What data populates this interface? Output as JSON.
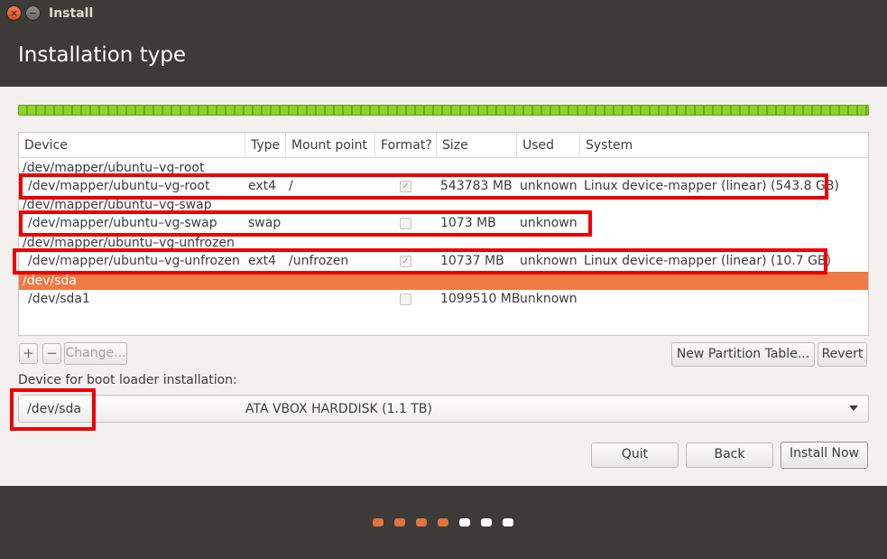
{
  "window": {
    "title": "Install"
  },
  "page": {
    "title": "Installation type"
  },
  "progress": {
    "fraction": 1.0,
    "color": "#8fd12b"
  },
  "table": {
    "headers": [
      "Device",
      "Type",
      "Mount point",
      "Format?",
      "Size",
      "Used",
      "System"
    ],
    "groups": [
      {
        "name": "/dev/mapper/ubuntu–vg-root",
        "rows": [
          {
            "device": "/dev/mapper/ubuntu–vg-root",
            "type": "ext4",
            "mount": "/",
            "format": true,
            "size": "543783 MB",
            "used": "unknown",
            "system": "Linux device-mapper (linear) (543.8 GB)"
          }
        ]
      },
      {
        "name": "/dev/mapper/ubuntu–vg-swap",
        "rows": [
          {
            "device": "/dev/mapper/ubuntu–vg-swap",
            "type": "swap",
            "mount": "",
            "format": false,
            "size": "1073 MB",
            "used": "unknown",
            "system": ""
          }
        ]
      },
      {
        "name": "/dev/mapper/ubuntu–vg-unfrozen",
        "rows": [
          {
            "device": "/dev/mapper/ubuntu–vg-unfrozen",
            "type": "ext4",
            "mount": "/unfrozen",
            "format": true,
            "size": "10737 MB",
            "used": "unknown",
            "system": "Linux device-mapper (linear) (10.7 GB)"
          }
        ]
      },
      {
        "name": "/dev/sda",
        "selected": true,
        "rows": [
          {
            "device": "/dev/sda1",
            "type": "",
            "mount": "",
            "format": false,
            "size": "1099510 MB",
            "used": "unknown",
            "system": ""
          }
        ]
      }
    ]
  },
  "partition_toolbar": {
    "add_label": "+",
    "remove_label": "−",
    "change_label": "Change...",
    "new_table_label": "New Partition Table...",
    "revert_label": "Revert"
  },
  "bootloader": {
    "label": "Device for boot loader installation:",
    "device": "/dev/sda",
    "description": "ATA VBOX HARDDISK (1.1 TB)"
  },
  "actions": {
    "quit": "Quit",
    "back": "Back",
    "install": "Install Now"
  },
  "steps": {
    "total": 7,
    "done": 4,
    "done_color": "#e0743e",
    "todo_color": "#ffffff"
  },
  "colors": {
    "selection": "#ef7a45",
    "highlight": "#ee0000",
    "accent": "#dd4814"
  }
}
